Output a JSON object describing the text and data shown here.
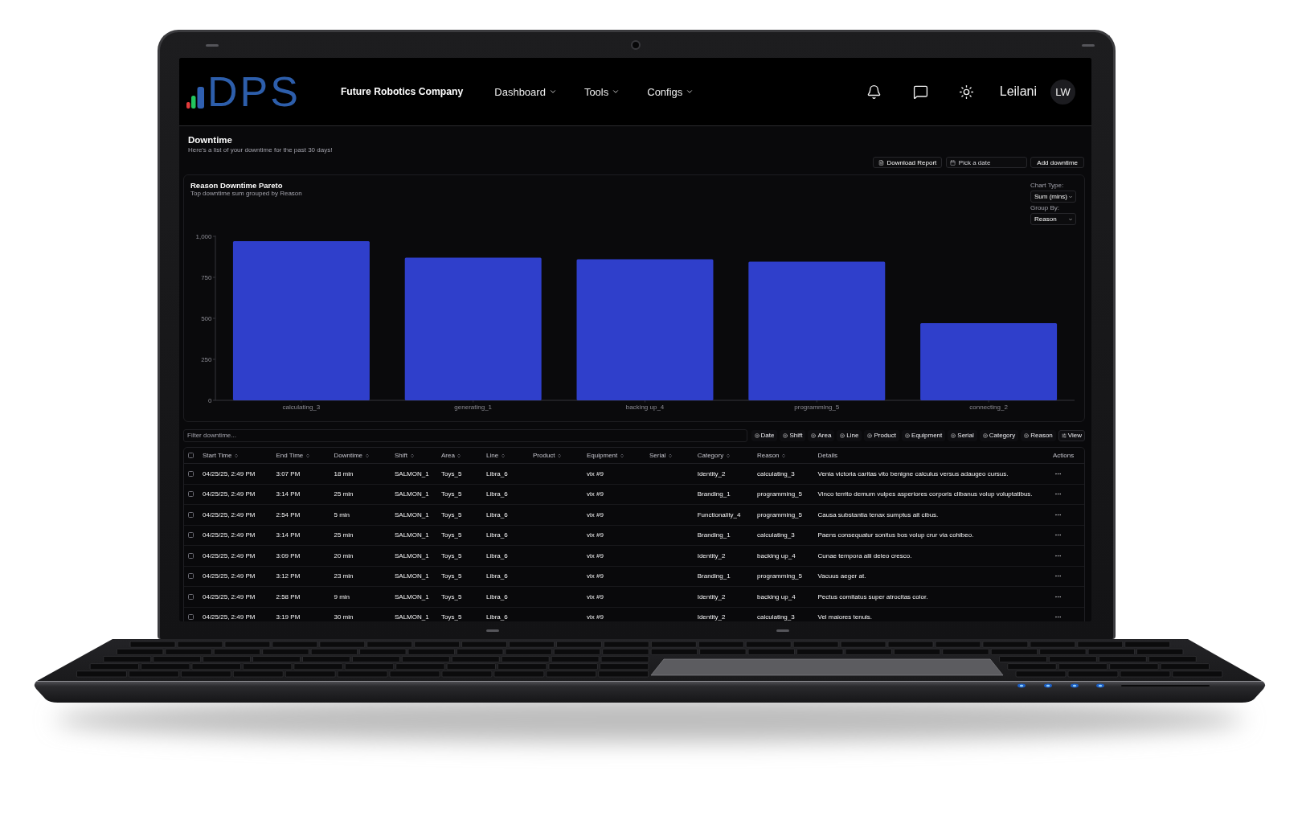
{
  "header": {
    "logo": "DPS",
    "company": "Future Robotics Company",
    "nav": [
      {
        "label": "Dashboard"
      },
      {
        "label": "Tools"
      },
      {
        "label": "Configs"
      }
    ],
    "user": {
      "name": "Leilani",
      "initials": "LW"
    }
  },
  "page": {
    "title": "Downtime",
    "subtitle": "Here's a list of your downtime for the past 30 days!",
    "actions": [
      {
        "kind": "export",
        "label": "Download Report"
      },
      {
        "kind": "date",
        "placeholder": "Pick a date"
      },
      {
        "kind": "button",
        "label": "Add downtime"
      }
    ]
  },
  "chart_card": {
    "title": "Reason Downtime Pareto",
    "subtitle": "Top downtime sum grouped by Reason",
    "controls": [
      {
        "label": "Chart Type:",
        "value": "Sum (mins)"
      },
      {
        "label": "Group By:",
        "value": "Reason"
      }
    ],
    "chart_data": {
      "type": "bar",
      "categories": [
        "calculating_3",
        "generating_1",
        "backing up_4",
        "programming_5",
        "connecting_2"
      ],
      "values": [
        970,
        870,
        860,
        845,
        470
      ],
      "ylim": [
        0,
        1000
      ],
      "yticks": [
        0,
        250,
        500,
        750,
        {
          "value": 1000,
          "label": "1,000"
        }
      ]
    }
  },
  "filter": {
    "placeholder": "Filter downtime...",
    "chips": [
      {
        "label": "Date"
      },
      {
        "label": "Shift"
      },
      {
        "label": "Area"
      },
      {
        "label": "Line"
      },
      {
        "label": "Product"
      },
      {
        "label": "Equipment"
      },
      {
        "label": "Serial"
      },
      {
        "label": "Category"
      },
      {
        "label": "Reason"
      }
    ],
    "view": "View"
  },
  "table": {
    "all_selected": false,
    "columns": [
      {
        "label": "Start Time",
        "sortable": true
      },
      {
        "label": "End Time",
        "sortable": true
      },
      {
        "label": "Downtime",
        "sortable": true
      },
      {
        "label": "Shift",
        "sortable": true
      },
      {
        "label": "Area",
        "sortable": true
      },
      {
        "label": "Line",
        "sortable": true
      },
      {
        "label": "Product",
        "sortable": true
      },
      {
        "label": "Equipment",
        "sortable": true
      },
      {
        "label": "Serial",
        "sortable": true
      },
      {
        "label": "Category",
        "sortable": true
      },
      {
        "label": "Reason",
        "sortable": true
      },
      {
        "label": "Details",
        "sortable": false
      },
      {
        "label": "Actions",
        "sortable": false
      }
    ],
    "rows": [
      {
        "selected": false,
        "start_time": "04/25/25, 2:49 PM",
        "end_time": "3:07 PM",
        "downtime": "18 min",
        "shift": "SALMON_1",
        "area": "Toys_5",
        "line": "Libra_6",
        "equipment": "vix #9",
        "category": "Identity_2",
        "reason": "calculating_3",
        "details": "Venia victoria caritas vito benigne calculus versus adaugeo cursus."
      },
      {
        "selected": false,
        "start_time": "04/25/25, 2:49 PM",
        "end_time": "3:14 PM",
        "downtime": "25 min",
        "shift": "SALMON_1",
        "area": "Toys_5",
        "line": "Libra_6",
        "equipment": "vix #9",
        "category": "Branding_1",
        "reason": "programming_5",
        "details": "Vinco territo demum vulpes asperiores corporis clibanus volup voluptatibus."
      },
      {
        "selected": false,
        "start_time": "04/25/25, 2:49 PM",
        "end_time": "2:54 PM",
        "downtime": "5 min",
        "shift": "SALMON_1",
        "area": "Toys_5",
        "line": "Libra_6",
        "equipment": "vix #9",
        "category": "Functionality_4",
        "reason": "programming_5",
        "details": "Causa substantia tenax sumptus ait cibus."
      },
      {
        "selected": false,
        "start_time": "04/25/25, 2:49 PM",
        "end_time": "3:14 PM",
        "downtime": "25 min",
        "shift": "SALMON_1",
        "area": "Toys_5",
        "line": "Libra_6",
        "equipment": "vix #9",
        "category": "Branding_1",
        "reason": "calculating_3",
        "details": "Paens consequatur sonitus bos volup crur via cohibeo."
      },
      {
        "selected": false,
        "start_time": "04/25/25, 2:49 PM",
        "end_time": "3:09 PM",
        "downtime": "20 min",
        "shift": "SALMON_1",
        "area": "Toys_5",
        "line": "Libra_6",
        "equipment": "vix #9",
        "category": "Identity_2",
        "reason": "backing up_4",
        "details": "Cunae tempora alii deleo cresco."
      },
      {
        "selected": false,
        "start_time": "04/25/25, 2:49 PM",
        "end_time": "3:12 PM",
        "downtime": "23 min",
        "shift": "SALMON_1",
        "area": "Toys_5",
        "line": "Libra_6",
        "equipment": "vix #9",
        "category": "Branding_1",
        "reason": "programming_5",
        "details": "Vacuus aeger at."
      },
      {
        "selected": false,
        "start_time": "04/25/25, 2:49 PM",
        "end_time": "2:58 PM",
        "downtime": "9 min",
        "shift": "SALMON_1",
        "area": "Toys_5",
        "line": "Libra_6",
        "equipment": "vix #9",
        "category": "Identity_2",
        "reason": "backing up_4",
        "details": "Pectus comitatus super atrocitas color."
      },
      {
        "selected": false,
        "start_time": "04/25/25, 2:49 PM",
        "end_time": "3:19 PM",
        "downtime": "30 min",
        "shift": "SALMON_1",
        "area": "Toys_5",
        "line": "Libra_6",
        "equipment": "vix #9",
        "category": "Identity_2",
        "reason": "calculating_3",
        "details": "Vel maiores tenuis."
      }
    ]
  }
}
